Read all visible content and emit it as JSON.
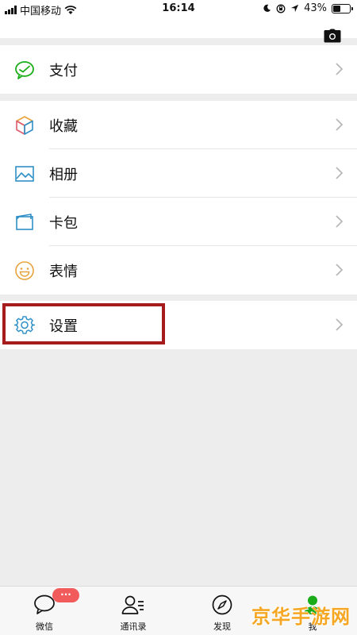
{
  "status_bar": {
    "carrier": "中国移动",
    "time": "16:14",
    "battery": "43%",
    "battery_level": 0.43
  },
  "menu": {
    "pay": {
      "label": "支付",
      "icon": "wechat-pay-icon",
      "color": "#1aad19"
    },
    "favorites": {
      "label": "收藏",
      "icon": "favorites-cube-icon"
    },
    "album": {
      "label": "相册",
      "icon": "photo-album-icon",
      "color": "#2f8fc7"
    },
    "cards": {
      "label": "卡包",
      "icon": "card-wallet-icon",
      "color": "#2f8fc7"
    },
    "stickers": {
      "label": "表情",
      "icon": "sticker-smile-icon",
      "color": "#e8a33d"
    },
    "settings": {
      "label": "设置",
      "icon": "settings-gear-icon",
      "color": "#2f8fc7"
    }
  },
  "tabbar": {
    "chats": {
      "label": "微信",
      "badge": "···"
    },
    "contacts": {
      "label": "通讯录"
    },
    "discover": {
      "label": "发现"
    },
    "me": {
      "label": "我",
      "active_color": "#1aad19"
    }
  },
  "watermark": "京华手游网"
}
